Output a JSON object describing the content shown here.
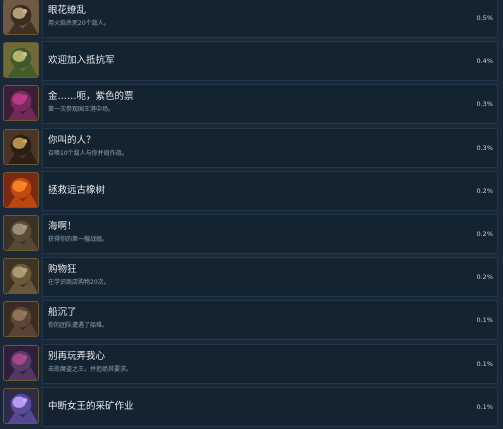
{
  "achievements": [
    {
      "title": "眼花缭乱",
      "desc": "用火焰杀死20个敌人。",
      "pct": "0.5%",
      "icon": "flower-monster-icon",
      "colors": [
        "#6e5a44",
        "#c9b28a",
        "#3a2c20"
      ]
    },
    {
      "title": "欢迎加入抵抗军",
      "desc": "",
      "pct": "0.4%",
      "icon": "rebel-soldier-icon",
      "colors": [
        "#6f6a3a",
        "#cfc27a",
        "#3c5a2a"
      ]
    },
    {
      "title": "金……呃，紫色的票",
      "desc": "第一次参观国王港中场。",
      "pct": "0.3%",
      "icon": "purple-ticket-icon",
      "colors": [
        "#3b1f35",
        "#c23a8f",
        "#7a2a5c"
      ]
    },
    {
      "title": "你叫的人？",
      "desc": "召唤10个敌人与你并肩作战。",
      "pct": "0.3%",
      "icon": "bell-icon",
      "colors": [
        "#4a3526",
        "#c9a35a",
        "#2a1e16"
      ]
    },
    {
      "title": "拯救远古橡树",
      "desc": "",
      "pct": "0.2%",
      "icon": "fiery-oak-icon",
      "colors": [
        "#7a2a10",
        "#ff8a2a",
        "#c04a10"
      ]
    },
    {
      "title": "海啊！",
      "desc": "获得你的第一艘战舰。",
      "pct": "0.2%",
      "icon": "ship-icon",
      "colors": [
        "#3a3226",
        "#a59a86",
        "#5b4a38"
      ]
    },
    {
      "title": "购物狂",
      "desc": "在学识商店购物20次。",
      "pct": "0.2%",
      "icon": "treasure-chest-icon",
      "colors": [
        "#3e3426",
        "#b8a47c",
        "#6b5a3c"
      ]
    },
    {
      "title": "船沉了",
      "desc": "你的团队遭遇了船难。",
      "pct": "0.1%",
      "icon": "sunken-ship-icon",
      "colors": [
        "#3a2c22",
        "#9a7a5a",
        "#5c4636"
      ]
    },
    {
      "title": "别再玩弄我心",
      "desc": "击败魔盗之王，并拒绝其要求。",
      "pct": "0.1%",
      "icon": "demon-queen-icon",
      "colors": [
        "#2e1f3a",
        "#b04a8a",
        "#5a3a6a"
      ]
    },
    {
      "title": "中断女王的采矿作业",
      "desc": "",
      "pct": "0.1%",
      "icon": "crystal-mine-icon",
      "colors": [
        "#2e2a4a",
        "#c8a8ff",
        "#5a4a9a"
      ]
    }
  ]
}
